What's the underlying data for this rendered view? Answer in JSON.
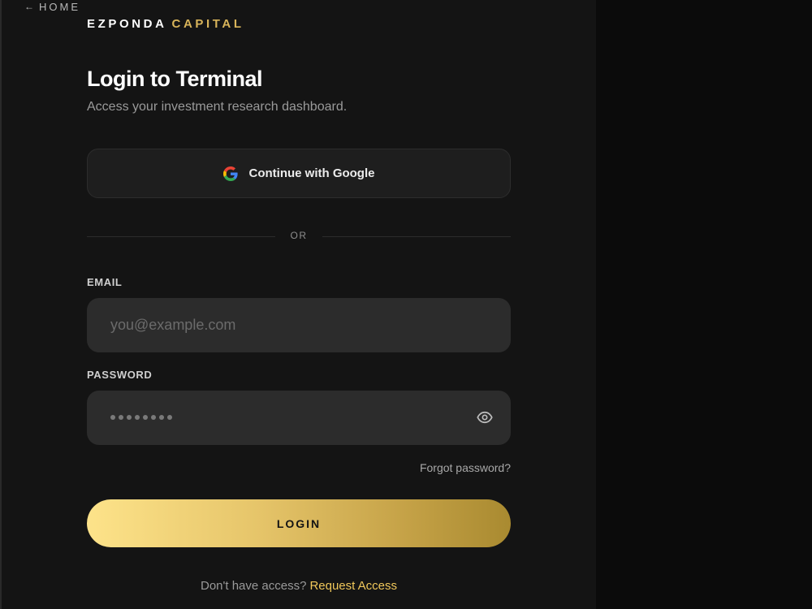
{
  "nav": {
    "home_arrow": "←",
    "home_label": "HOME"
  },
  "brand": {
    "part1": "EZPONDA",
    "part2": "CAPITAL",
    "accent_color": "#d8b45a"
  },
  "header": {
    "title": "Login to Terminal",
    "subtitle": "Access your investment research dashboard."
  },
  "google": {
    "label": "Continue with Google",
    "icon": "google-g-icon"
  },
  "divider": {
    "text": "OR"
  },
  "email": {
    "label": "EMAIL",
    "placeholder": "you@example.com",
    "value": ""
  },
  "password": {
    "label": "PASSWORD",
    "masked_length": 8,
    "toggle_icon": "eye-icon"
  },
  "forgot": {
    "label": "Forgot password?"
  },
  "login": {
    "label": "LOGIN"
  },
  "footer": {
    "prompt": "Don't have access?",
    "link": "Request Access",
    "link_color": "#f0c75a"
  }
}
